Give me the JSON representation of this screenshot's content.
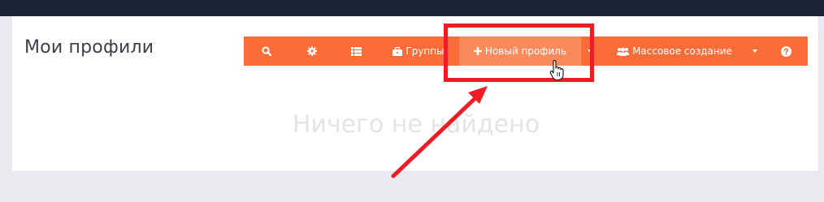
{
  "header": {
    "title": "Мои профили"
  },
  "toolbar": {
    "search_icon": "search-icon",
    "settings_icon": "gear-icon",
    "list_icon": "list-icon",
    "groups_label": "Группы",
    "new_profile_label": "Новый профиль",
    "bulk_create_label": "Массовое создание",
    "help_icon": "question-circle-icon",
    "background_color": "#fb6d38",
    "highlight_color": "#fc8a5c"
  },
  "main": {
    "empty_message": "Ничего не найдено"
  },
  "annotation": {
    "box_color": "#ee1c24",
    "arrow_color": "#ee1c24"
  }
}
